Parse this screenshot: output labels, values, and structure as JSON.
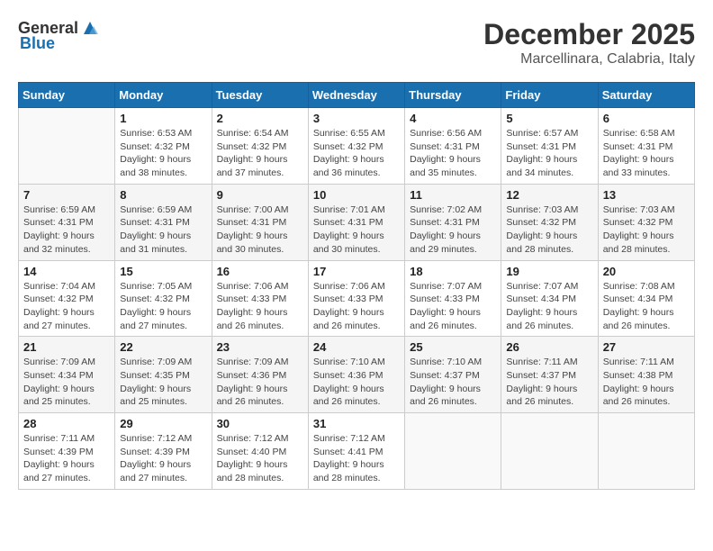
{
  "header": {
    "logo_general": "General",
    "logo_blue": "Blue",
    "month": "December 2025",
    "location": "Marcellinara, Calabria, Italy"
  },
  "weekdays": [
    "Sunday",
    "Monday",
    "Tuesday",
    "Wednesday",
    "Thursday",
    "Friday",
    "Saturday"
  ],
  "weeks": [
    [
      {
        "day": "",
        "info": ""
      },
      {
        "day": "1",
        "info": "Sunrise: 6:53 AM\nSunset: 4:32 PM\nDaylight: 9 hours\nand 38 minutes."
      },
      {
        "day": "2",
        "info": "Sunrise: 6:54 AM\nSunset: 4:32 PM\nDaylight: 9 hours\nand 37 minutes."
      },
      {
        "day": "3",
        "info": "Sunrise: 6:55 AM\nSunset: 4:32 PM\nDaylight: 9 hours\nand 36 minutes."
      },
      {
        "day": "4",
        "info": "Sunrise: 6:56 AM\nSunset: 4:31 PM\nDaylight: 9 hours\nand 35 minutes."
      },
      {
        "day": "5",
        "info": "Sunrise: 6:57 AM\nSunset: 4:31 PM\nDaylight: 9 hours\nand 34 minutes."
      },
      {
        "day": "6",
        "info": "Sunrise: 6:58 AM\nSunset: 4:31 PM\nDaylight: 9 hours\nand 33 minutes."
      }
    ],
    [
      {
        "day": "7",
        "info": "Sunrise: 6:59 AM\nSunset: 4:31 PM\nDaylight: 9 hours\nand 32 minutes."
      },
      {
        "day": "8",
        "info": "Sunrise: 6:59 AM\nSunset: 4:31 PM\nDaylight: 9 hours\nand 31 minutes."
      },
      {
        "day": "9",
        "info": "Sunrise: 7:00 AM\nSunset: 4:31 PM\nDaylight: 9 hours\nand 30 minutes."
      },
      {
        "day": "10",
        "info": "Sunrise: 7:01 AM\nSunset: 4:31 PM\nDaylight: 9 hours\nand 30 minutes."
      },
      {
        "day": "11",
        "info": "Sunrise: 7:02 AM\nSunset: 4:31 PM\nDaylight: 9 hours\nand 29 minutes."
      },
      {
        "day": "12",
        "info": "Sunrise: 7:03 AM\nSunset: 4:32 PM\nDaylight: 9 hours\nand 28 minutes."
      },
      {
        "day": "13",
        "info": "Sunrise: 7:03 AM\nSunset: 4:32 PM\nDaylight: 9 hours\nand 28 minutes."
      }
    ],
    [
      {
        "day": "14",
        "info": "Sunrise: 7:04 AM\nSunset: 4:32 PM\nDaylight: 9 hours\nand 27 minutes."
      },
      {
        "day": "15",
        "info": "Sunrise: 7:05 AM\nSunset: 4:32 PM\nDaylight: 9 hours\nand 27 minutes."
      },
      {
        "day": "16",
        "info": "Sunrise: 7:06 AM\nSunset: 4:33 PM\nDaylight: 9 hours\nand 26 minutes."
      },
      {
        "day": "17",
        "info": "Sunrise: 7:06 AM\nSunset: 4:33 PM\nDaylight: 9 hours\nand 26 minutes."
      },
      {
        "day": "18",
        "info": "Sunrise: 7:07 AM\nSunset: 4:33 PM\nDaylight: 9 hours\nand 26 minutes."
      },
      {
        "day": "19",
        "info": "Sunrise: 7:07 AM\nSunset: 4:34 PM\nDaylight: 9 hours\nand 26 minutes."
      },
      {
        "day": "20",
        "info": "Sunrise: 7:08 AM\nSunset: 4:34 PM\nDaylight: 9 hours\nand 26 minutes."
      }
    ],
    [
      {
        "day": "21",
        "info": "Sunrise: 7:09 AM\nSunset: 4:34 PM\nDaylight: 9 hours\nand 25 minutes."
      },
      {
        "day": "22",
        "info": "Sunrise: 7:09 AM\nSunset: 4:35 PM\nDaylight: 9 hours\nand 25 minutes."
      },
      {
        "day": "23",
        "info": "Sunrise: 7:09 AM\nSunset: 4:36 PM\nDaylight: 9 hours\nand 26 minutes."
      },
      {
        "day": "24",
        "info": "Sunrise: 7:10 AM\nSunset: 4:36 PM\nDaylight: 9 hours\nand 26 minutes."
      },
      {
        "day": "25",
        "info": "Sunrise: 7:10 AM\nSunset: 4:37 PM\nDaylight: 9 hours\nand 26 minutes."
      },
      {
        "day": "26",
        "info": "Sunrise: 7:11 AM\nSunset: 4:37 PM\nDaylight: 9 hours\nand 26 minutes."
      },
      {
        "day": "27",
        "info": "Sunrise: 7:11 AM\nSunset: 4:38 PM\nDaylight: 9 hours\nand 26 minutes."
      }
    ],
    [
      {
        "day": "28",
        "info": "Sunrise: 7:11 AM\nSunset: 4:39 PM\nDaylight: 9 hours\nand 27 minutes."
      },
      {
        "day": "29",
        "info": "Sunrise: 7:12 AM\nSunset: 4:39 PM\nDaylight: 9 hours\nand 27 minutes."
      },
      {
        "day": "30",
        "info": "Sunrise: 7:12 AM\nSunset: 4:40 PM\nDaylight: 9 hours\nand 28 minutes."
      },
      {
        "day": "31",
        "info": "Sunrise: 7:12 AM\nSunset: 4:41 PM\nDaylight: 9 hours\nand 28 minutes."
      },
      {
        "day": "",
        "info": ""
      },
      {
        "day": "",
        "info": ""
      },
      {
        "day": "",
        "info": ""
      }
    ]
  ]
}
